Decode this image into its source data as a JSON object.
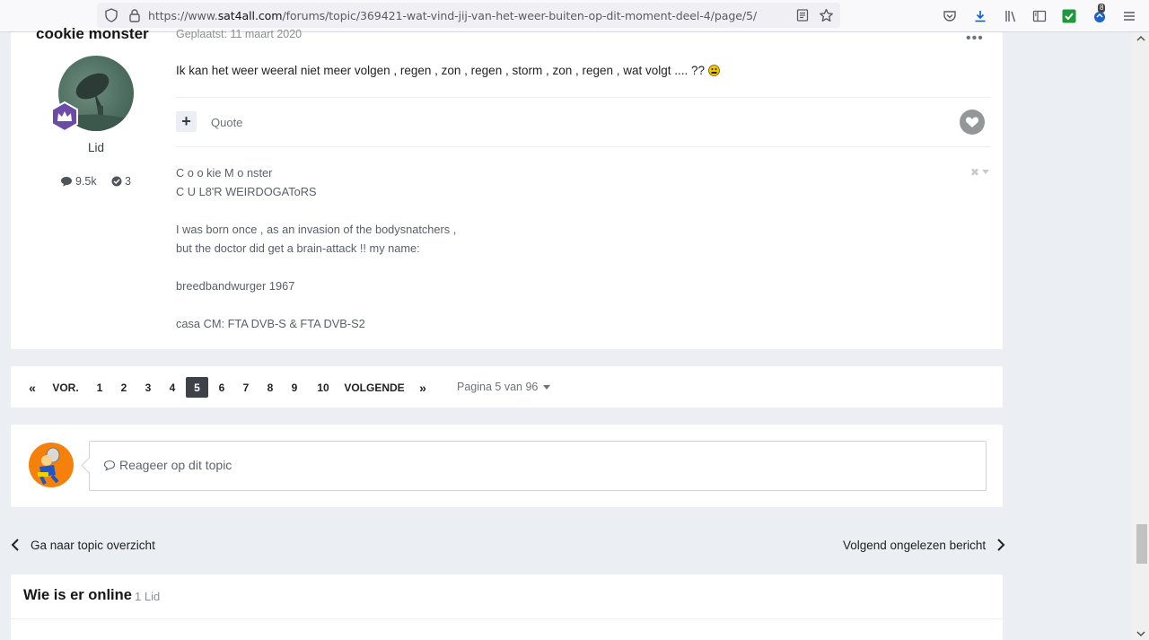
{
  "browser": {
    "url_prefix": "https://www.",
    "url_domain": "sat4all.com",
    "url_path": "/forums/topic/369421-wat-vind-jij-van-het-weer-buiten-op-dit-moment-deel-4/page/5/",
    "extensions_badge": "8"
  },
  "post": {
    "author": "cookie monster",
    "date": "Geplaatst: 11 maart 2020",
    "role": "Lid",
    "posts_count": "9.5k",
    "solutions_count": "3",
    "body": "Ik kan het weer weeral niet meer volgen , regen , zon , regen , storm , zon , regen , wat volgt  .... ??",
    "quote_label": "Quote",
    "signature": [
      "C o o kie M o nster",
      "C U L8'R WEIRDOGAToRS",
      "",
      "I was born once , as an invasion of the bodysnatchers ,",
      "but the doctor did get a brain-attack !! my name:",
      "",
      "breedbandwurger 1967",
      "",
      "casa CM: FTA DVB-S & FTA DVB-S2"
    ]
  },
  "pagination": {
    "first": "«",
    "prev": "VOR.",
    "pages": [
      "1",
      "2",
      "3",
      "4",
      "5",
      "6",
      "7",
      "8",
      "9",
      "10"
    ],
    "current": "5",
    "next": "VOLGENDE",
    "last": "»",
    "page_info": "Pagina 5 van 96"
  },
  "reply": {
    "placeholder": "Reageer op dit topic"
  },
  "navigation": {
    "back_label": "Ga naar topic overzicht",
    "next_label": "Volgend ongelezen bericht"
  },
  "online": {
    "title": "Wie is er online",
    "count": "1 Lid"
  }
}
